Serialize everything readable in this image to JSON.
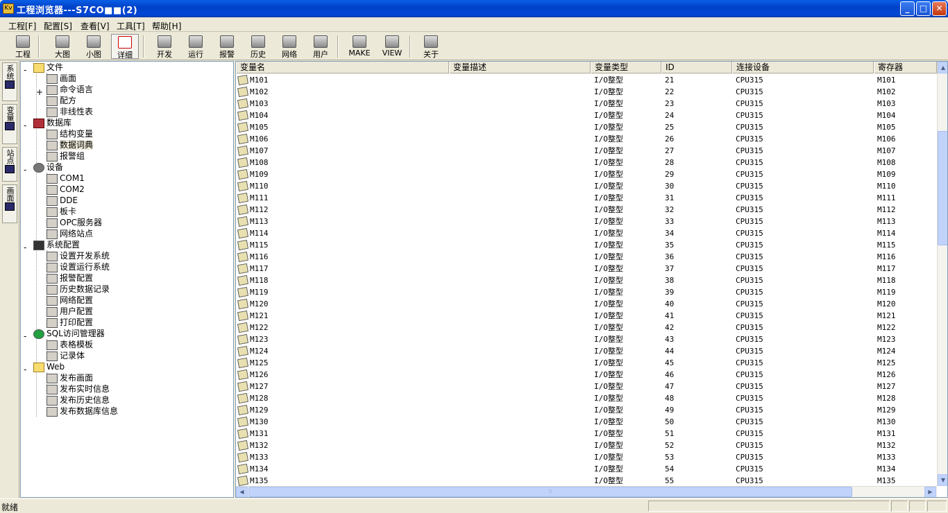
{
  "window": {
    "title": "工程浏览器---S7CO■■(2)",
    "app_icon": "Kv"
  },
  "window_controls": {
    "minimize": "_",
    "maximize": "□",
    "close": "✕"
  },
  "menu": [
    "工程[F]",
    "配置[S]",
    "查看[V]",
    "工具[T]",
    "帮助[H]"
  ],
  "toolbar": [
    "工程",
    "大图",
    "小图",
    "详细",
    "开发",
    "运行",
    "报警",
    "历史",
    "网络",
    "用户",
    "MAKE",
    "VIEW",
    "关于"
  ],
  "side_tabs": [
    "系统",
    "变量",
    "站点",
    "画面"
  ],
  "tree": [
    {
      "label": "文件",
      "icon": "folder-icon"
    },
    {
      "label": "画面",
      "icon": "screen-icon"
    },
    {
      "label": "命令语言",
      "icon": "script-icon"
    },
    {
      "label": "配方",
      "icon": "recipe-icon"
    },
    {
      "label": "非线性表",
      "icon": "table-icon"
    },
    {
      "label": "数据库",
      "icon": "database-icon"
    },
    {
      "label": "结构变量",
      "icon": "struct-icon"
    },
    {
      "label": "数据词典",
      "icon": "dictionary-icon"
    },
    {
      "label": "报警组",
      "icon": "alarm-group-icon"
    },
    {
      "label": "设备",
      "icon": "device-icon"
    },
    {
      "label": "COM1",
      "icon": "serial-port-icon"
    },
    {
      "label": "COM2",
      "icon": "serial-port-icon"
    },
    {
      "label": "DDE",
      "icon": "dde-icon"
    },
    {
      "label": "板卡",
      "icon": "card-icon"
    },
    {
      "label": "OPC服务器",
      "icon": "opc-icon"
    },
    {
      "label": "网络站点",
      "icon": "network-icon"
    },
    {
      "label": "系统配置",
      "icon": "tools-icon"
    },
    {
      "label": "设置开发系统",
      "icon": "dev-settings-icon"
    },
    {
      "label": "设置运行系统",
      "icon": "run-settings-icon"
    },
    {
      "label": "报警配置",
      "icon": "alarm-config-icon"
    },
    {
      "label": "历史数据记录",
      "icon": "history-icon"
    },
    {
      "label": "网络配置",
      "icon": "net-config-icon"
    },
    {
      "label": "用户配置",
      "icon": "user-icon"
    },
    {
      "label": "打印配置",
      "icon": "printer-icon"
    },
    {
      "label": "SQL访问管理器",
      "icon": "sql-icon"
    },
    {
      "label": "表格模板",
      "icon": "template-icon"
    },
    {
      "label": "记录体",
      "icon": "record-icon"
    },
    {
      "label": "Web",
      "icon": "folder-icon"
    },
    {
      "label": "发布画面",
      "icon": "publish-screen-icon"
    },
    {
      "label": "发布实时信息",
      "icon": "publish-realtime-icon"
    },
    {
      "label": "发布历史信息",
      "icon": "publish-history-icon"
    },
    {
      "label": "发布数据库信息",
      "icon": "publish-db-icon"
    }
  ],
  "expanders": [
    "-",
    "+",
    "-",
    "-",
    "-",
    "-",
    "-"
  ],
  "grid": {
    "columns": [
      "变量名",
      "变量描述",
      "变量类型",
      "ID",
      "连接设备",
      "寄存器"
    ],
    "rows": [
      [
        "M101",
        "",
        "I/O整型",
        "21",
        "CPU315",
        "M101"
      ],
      [
        "M102",
        "",
        "I/O整型",
        "22",
        "CPU315",
        "M102"
      ],
      [
        "M103",
        "",
        "I/O整型",
        "23",
        "CPU315",
        "M103"
      ],
      [
        "M104",
        "",
        "I/O整型",
        "24",
        "CPU315",
        "M104"
      ],
      [
        "M105",
        "",
        "I/O整型",
        "25",
        "CPU315",
        "M105"
      ],
      [
        "M106",
        "",
        "I/O整型",
        "26",
        "CPU315",
        "M106"
      ],
      [
        "M107",
        "",
        "I/O整型",
        "27",
        "CPU315",
        "M107"
      ],
      [
        "M108",
        "",
        "I/O整型",
        "28",
        "CPU315",
        "M108"
      ],
      [
        "M109",
        "",
        "I/O整型",
        "29",
        "CPU315",
        "M109"
      ],
      [
        "M110",
        "",
        "I/O整型",
        "30",
        "CPU315",
        "M110"
      ],
      [
        "M111",
        "",
        "I/O整型",
        "31",
        "CPU315",
        "M111"
      ],
      [
        "M112",
        "",
        "I/O整型",
        "32",
        "CPU315",
        "M112"
      ],
      [
        "M113",
        "",
        "I/O整型",
        "33",
        "CPU315",
        "M113"
      ],
      [
        "M114",
        "",
        "I/O整型",
        "34",
        "CPU315",
        "M114"
      ],
      [
        "M115",
        "",
        "I/O整型",
        "35",
        "CPU315",
        "M115"
      ],
      [
        "M116",
        "",
        "I/O整型",
        "36",
        "CPU315",
        "M116"
      ],
      [
        "M117",
        "",
        "I/O整型",
        "37",
        "CPU315",
        "M117"
      ],
      [
        "M118",
        "",
        "I/O整型",
        "38",
        "CPU315",
        "M118"
      ],
      [
        "M119",
        "",
        "I/O整型",
        "39",
        "CPU315",
        "M119"
      ],
      [
        "M120",
        "",
        "I/O整型",
        "40",
        "CPU315",
        "M120"
      ],
      [
        "M121",
        "",
        "I/O整型",
        "41",
        "CPU315",
        "M121"
      ],
      [
        "M122",
        "",
        "I/O整型",
        "42",
        "CPU315",
        "M122"
      ],
      [
        "M123",
        "",
        "I/O整型",
        "43",
        "CPU315",
        "M123"
      ],
      [
        "M124",
        "",
        "I/O整型",
        "44",
        "CPU315",
        "M124"
      ],
      [
        "M125",
        "",
        "I/O整型",
        "45",
        "CPU315",
        "M125"
      ],
      [
        "M126",
        "",
        "I/O整型",
        "46",
        "CPU315",
        "M126"
      ],
      [
        "M127",
        "",
        "I/O整型",
        "47",
        "CPU315",
        "M127"
      ],
      [
        "M128",
        "",
        "I/O整型",
        "48",
        "CPU315",
        "M128"
      ],
      [
        "M129",
        "",
        "I/O整型",
        "49",
        "CPU315",
        "M129"
      ],
      [
        "M130",
        "",
        "I/O整型",
        "50",
        "CPU315",
        "M130"
      ],
      [
        "M131",
        "",
        "I/O整型",
        "51",
        "CPU315",
        "M131"
      ],
      [
        "M132",
        "",
        "I/O整型",
        "52",
        "CPU315",
        "M132"
      ],
      [
        "M133",
        "",
        "I/O整型",
        "53",
        "CPU315",
        "M133"
      ],
      [
        "M134",
        "",
        "I/O整型",
        "54",
        "CPU315",
        "M134"
      ],
      [
        "M135",
        "",
        "I/O整型",
        "55",
        "CPU315",
        "M135"
      ]
    ]
  },
  "status": {
    "text": "就绪"
  }
}
